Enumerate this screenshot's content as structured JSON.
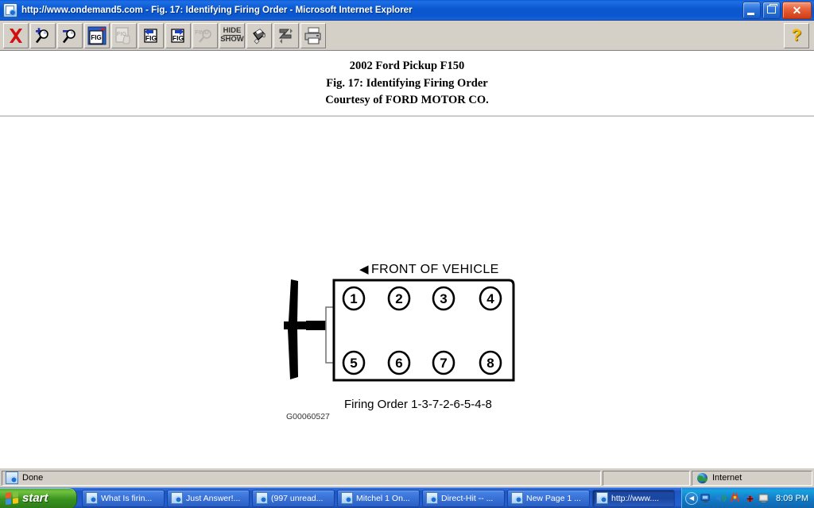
{
  "window": {
    "title": "http://www.ondemand5.com - Fig. 17: Identifying Firing Order - Microsoft Internet Explorer",
    "app_icon": "ie-document-icon",
    "minimize_label": "Minimize",
    "restore_label": "Restore",
    "close_label": "✕"
  },
  "toolbar": {
    "buttons": [
      {
        "name": "close-figure-button",
        "icon": "red-x-icon",
        "label": "X",
        "enabled": true
      },
      {
        "name": "zoom-in-button",
        "icon": "magnifier-plus-icon",
        "label": "Zoom In",
        "enabled": true
      },
      {
        "name": "zoom-out-button",
        "icon": "magnifier-minus-icon",
        "label": "Zoom Out",
        "enabled": true
      },
      {
        "name": "figure-window-button",
        "icon": "fig-window-icon",
        "label": "FIG",
        "enabled": true
      },
      {
        "name": "figure-drag-button",
        "icon": "fig-hand-icon",
        "label": "FIG",
        "enabled": false
      },
      {
        "name": "previous-figure-button",
        "icon": "fig-left-arrow-icon",
        "label": "FIG",
        "enabled": true
      },
      {
        "name": "next-figure-button",
        "icon": "fig-right-arrow-icon",
        "label": "FIG",
        "enabled": true
      },
      {
        "name": "find-figure-button",
        "icon": "find-magnifier-icon",
        "label": "FIND",
        "enabled": false
      },
      {
        "name": "hide-show-button",
        "icon": "hide-show-text-icon",
        "label": "HIDE SHOW",
        "enabled": true
      },
      {
        "name": "paint-bucket-button",
        "icon": "paint-bucket-icon",
        "label": "Fill",
        "enabled": true
      },
      {
        "name": "rotate-button",
        "icon": "rotate-arrows-icon",
        "label": "Rotate",
        "enabled": true
      },
      {
        "name": "print-button",
        "icon": "printer-icon",
        "label": "Print",
        "enabled": true
      }
    ],
    "hide_show_line1": "HIDE",
    "hide_show_line2": "SHOW",
    "help_label": "?",
    "help_name": "help-button"
  },
  "document": {
    "heading_line1": "2002 Ford Pickup F150",
    "heading_line2": "Fig. 17: Identifying Firing Order",
    "heading_line3": "Courtesy of FORD MOTOR CO."
  },
  "figure": {
    "front_arrow": "◀",
    "front_label": "FRONT OF VEHICLE",
    "firing_order_label": "Firing Order 1-3-7-2-6-5-4-8",
    "image_code": "G00060527",
    "cylinders_top": [
      "1",
      "2",
      "3",
      "4"
    ],
    "cylinders_bottom": [
      "5",
      "6",
      "7",
      "8"
    ],
    "firing_sequence": [
      1,
      3,
      7,
      2,
      6,
      5,
      4,
      8
    ]
  },
  "statusbar": {
    "status_text": "Done",
    "zone_text": "Internet",
    "status_icon": "ie-page-icon",
    "zone_icon": "globe-icon"
  },
  "taskbar": {
    "start_label": "start",
    "tasks": [
      {
        "label": "What Is firin...",
        "active": false
      },
      {
        "label": "Just Answer!...",
        "active": false
      },
      {
        "label": "(997 unread...",
        "active": false
      },
      {
        "label": "Mitchel 1 On...",
        "active": false
      },
      {
        "label": "Direct-Hit -- ...",
        "active": false
      },
      {
        "label": "New Page 1 ...",
        "active": false
      },
      {
        "label": "http://www....",
        "active": true
      }
    ],
    "tray_expand": "◀",
    "tray_icons": [
      "monitor-network-icon",
      "volume-icon",
      "norton-icon",
      "antivirus-icon",
      "display-icon"
    ],
    "clock": "8:09 PM"
  },
  "colors": {
    "titlebar_blue": "#0a57d0",
    "toolbar_gray": "#d4d0c8",
    "close_red": "#cf3c15",
    "start_green": "#39921f",
    "help_yellow": "#f5b800",
    "taskbar_blue": "#225fd2"
  }
}
